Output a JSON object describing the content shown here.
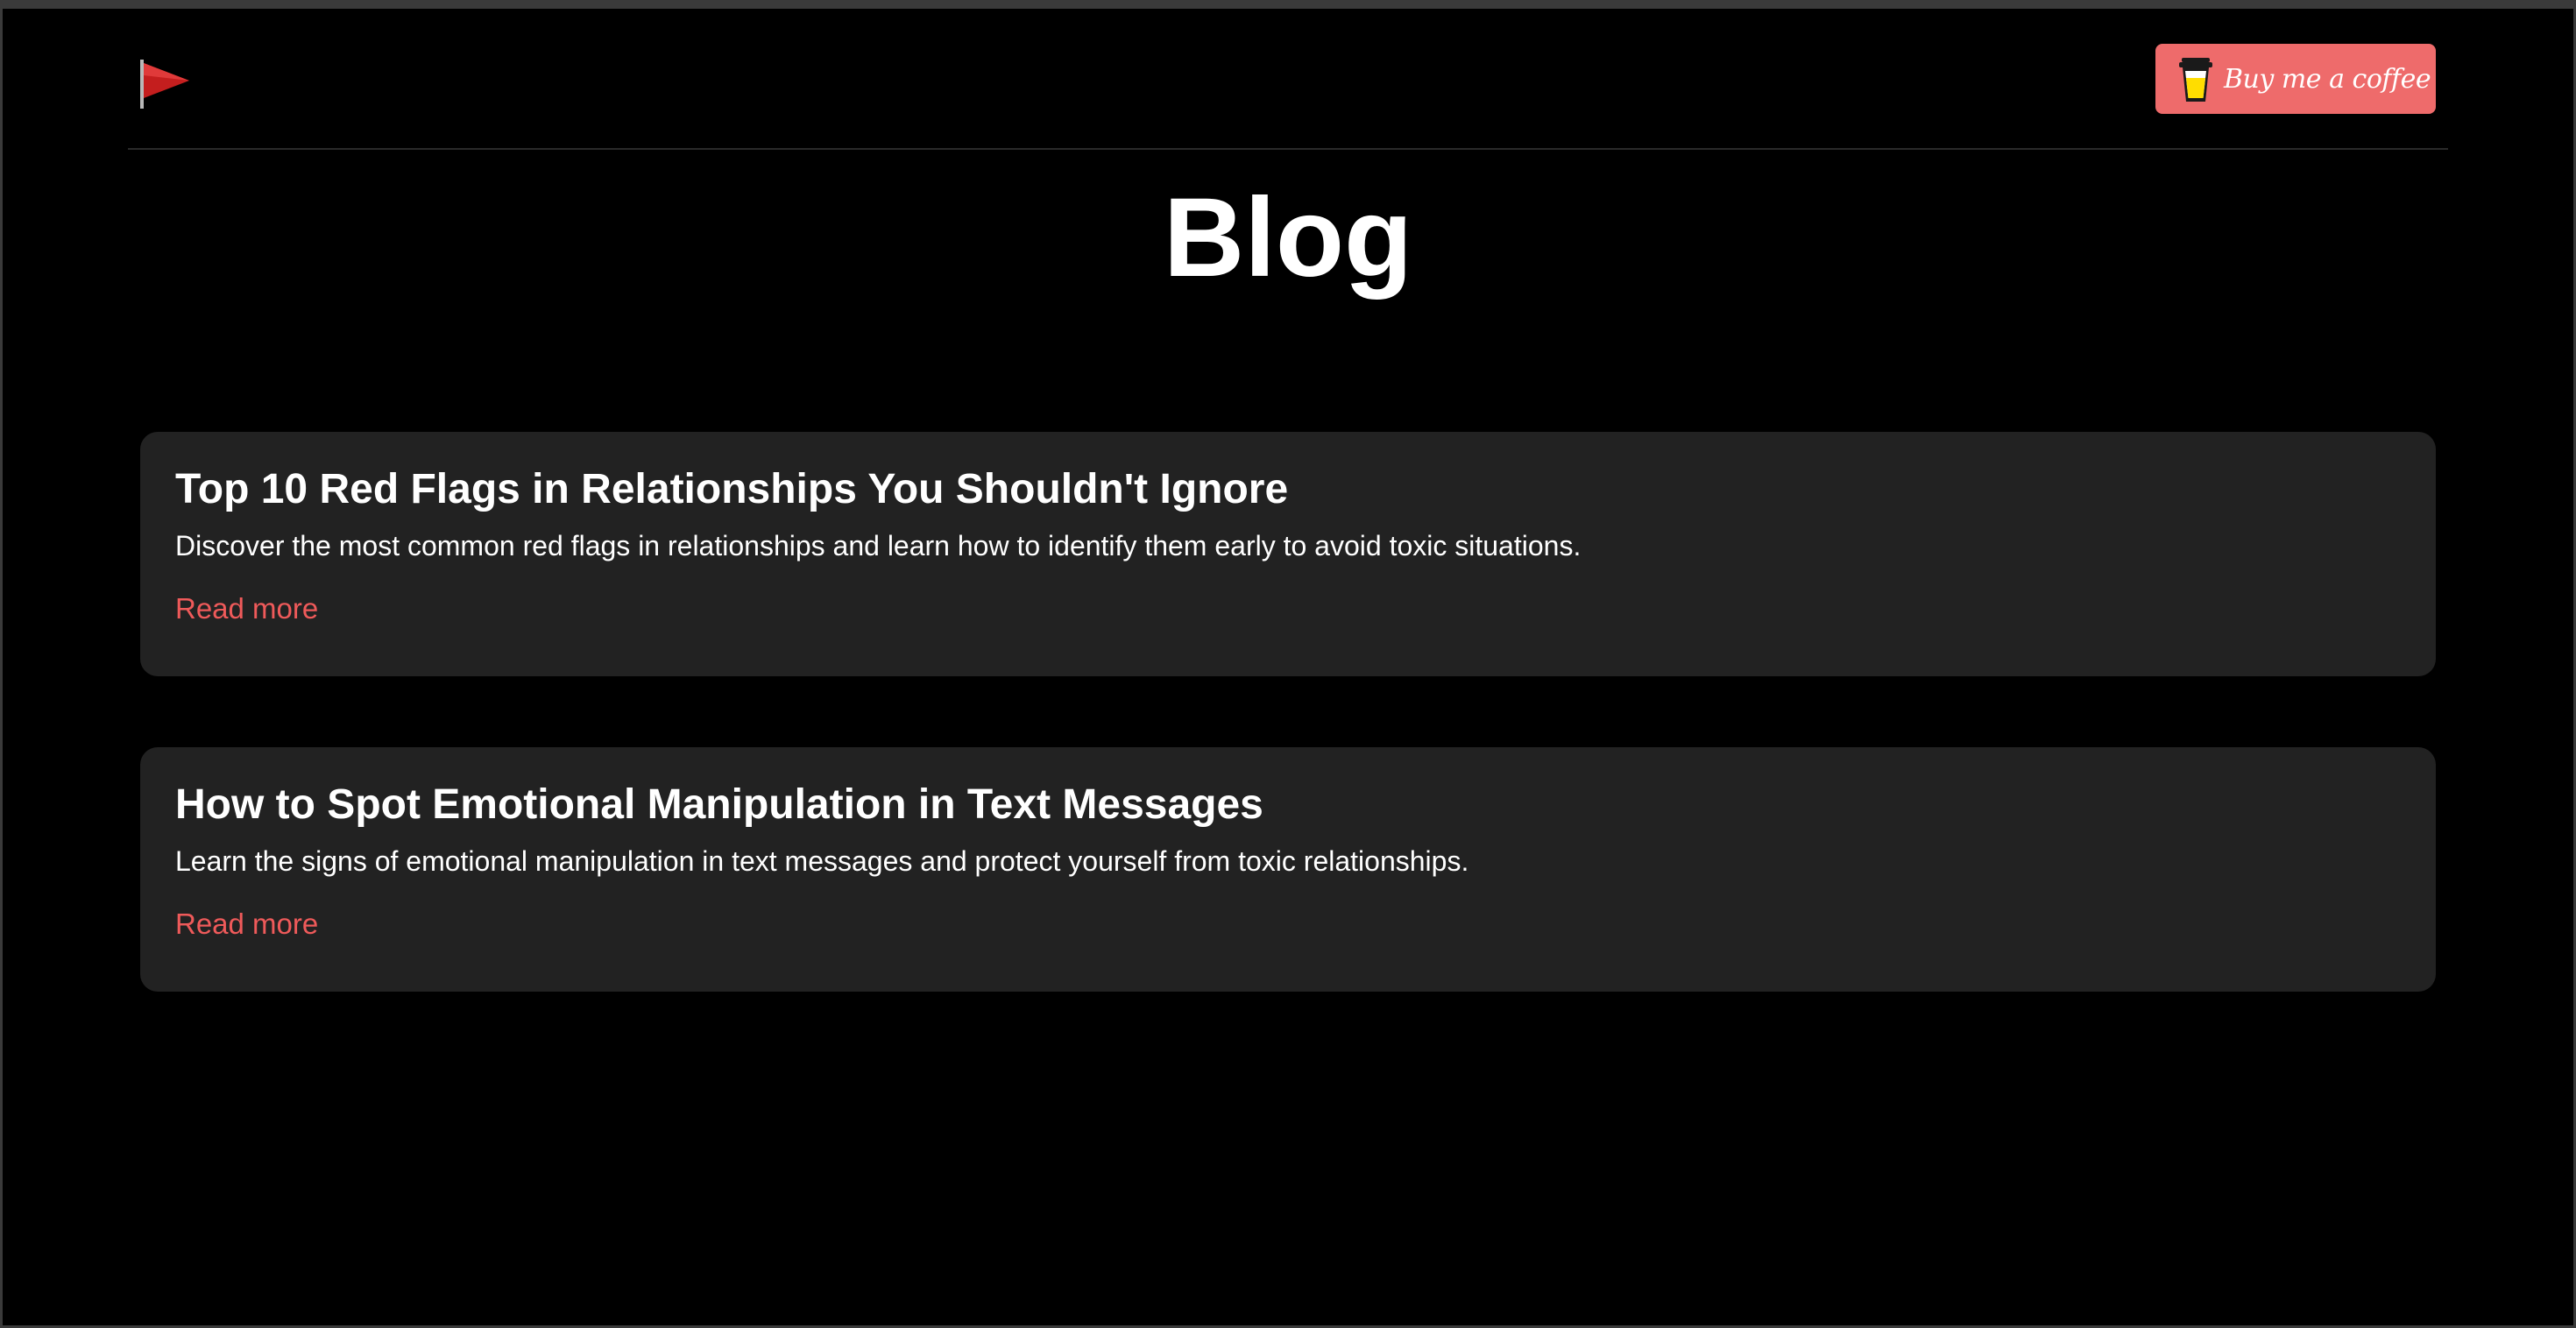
{
  "header": {
    "logo_icon": "red-flag-icon",
    "coffee_button": {
      "label": "Buy me a coffee",
      "icon": "coffee-cup-icon",
      "bg_color": "#ee6b6b"
    }
  },
  "page": {
    "title": "Blog"
  },
  "posts": [
    {
      "title": "Top 10 Red Flags in Relationships You Shouldn't Ignore",
      "excerpt": "Discover the most common red flags in relationships and learn how to identify them early to avoid toxic situations.",
      "link_label": "Read more"
    },
    {
      "title": "How to Spot Emotional Manipulation in Text Messages",
      "excerpt": "Learn the signs of emotional manipulation in text messages and protect yourself from toxic relationships.",
      "link_label": "Read more"
    }
  ],
  "colors": {
    "background": "#000000",
    "card": "#222222",
    "accent": "#ef5a5a",
    "text": "#ffffff"
  }
}
